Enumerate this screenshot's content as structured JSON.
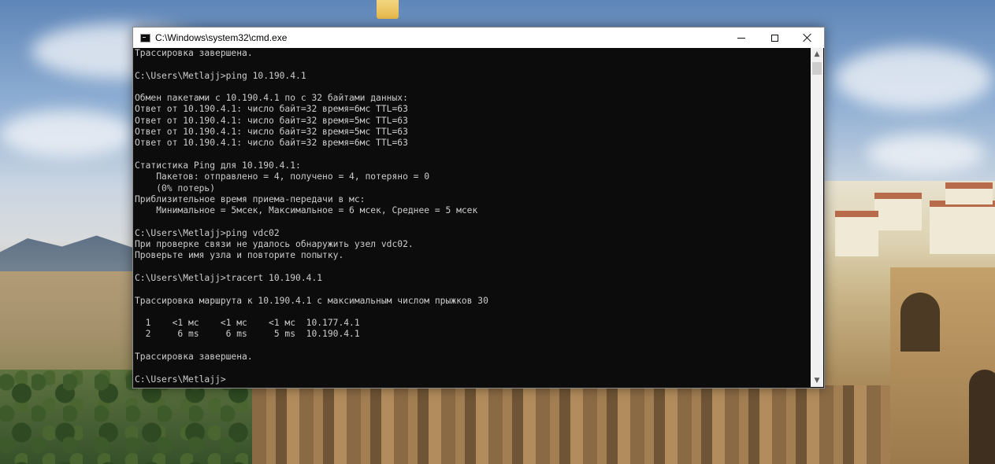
{
  "window": {
    "title": "C:\\Windows\\system32\\cmd.exe",
    "icon": "cmd-console-icon",
    "controls": {
      "minimize": "minimize-icon",
      "maximize": "maximize-icon",
      "close": "close-icon"
    }
  },
  "console": {
    "lines": [
      "Трассировка завершена.",
      "",
      "C:\\Users\\Metlajj>ping 10.190.4.1",
      "",
      "Обмен пакетами с 10.190.4.1 по с 32 байтами данных:",
      "Ответ от 10.190.4.1: число байт=32 время=6мс TTL=63",
      "Ответ от 10.190.4.1: число байт=32 время=5мс TTL=63",
      "Ответ от 10.190.4.1: число байт=32 время=5мс TTL=63",
      "Ответ от 10.190.4.1: число байт=32 время=6мс TTL=63",
      "",
      "Статистика Ping для 10.190.4.1:",
      "    Пакетов: отправлено = 4, получено = 4, потеряно = 0",
      "    (0% потерь)",
      "Приблизительное время приема-передачи в мс:",
      "    Минимальное = 5мсек, Максимальное = 6 мсек, Среднее = 5 мсек",
      "",
      "C:\\Users\\Metlajj>ping vdc02",
      "При проверке связи не удалось обнаружить узел vdc02.",
      "Проверьте имя узла и повторите попытку.",
      "",
      "C:\\Users\\Metlajj>tracert 10.190.4.1",
      "",
      "Трассировка маршрута к 10.190.4.1 с максимальным числом прыжков 30",
      "",
      "  1    <1 мс    <1 мс    <1 мс  10.177.4.1",
      "  2     6 ms     6 ms     5 ms  10.190.4.1",
      "",
      "Трассировка завершена.",
      "",
      "C:\\Users\\Metlajj>"
    ]
  },
  "scrollbar": {
    "up_icon": "▲",
    "down_icon": "▼"
  },
  "colors": {
    "console_bg": "#0c0c0c",
    "console_text": "#cccccc",
    "titlebar_bg": "#ffffff"
  },
  "desktop": {
    "folder_icon": "folder-icon"
  }
}
